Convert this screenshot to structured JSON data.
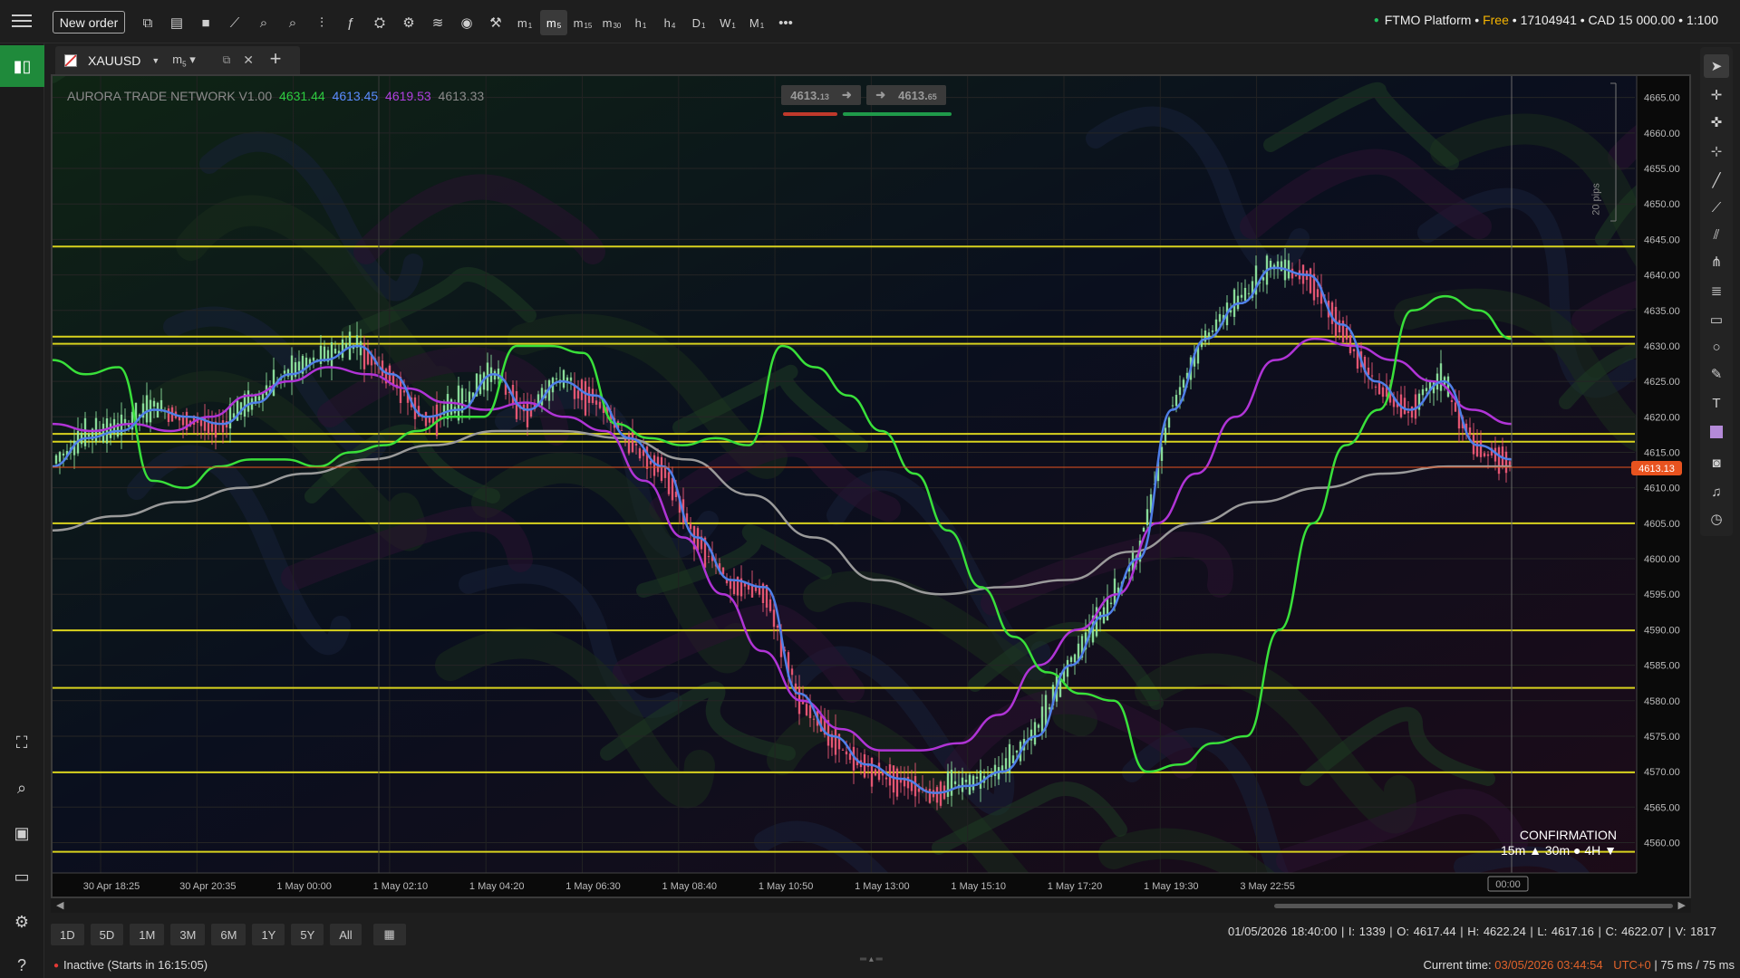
{
  "topbar": {
    "new_order": "New order",
    "timeframes": [
      {
        "base": "m",
        "sub": "1"
      },
      {
        "base": "m",
        "sub": "5"
      },
      {
        "base": "m",
        "sub": "15"
      },
      {
        "base": "m",
        "sub": "30"
      },
      {
        "base": "h",
        "sub": "1"
      },
      {
        "base": "h",
        "sub": "4"
      },
      {
        "base": "D",
        "sub": "1"
      },
      {
        "base": "W",
        "sub": "1"
      },
      {
        "base": "M",
        "sub": "1"
      }
    ],
    "active_timeframe": "m5",
    "more": "•••",
    "account_platform": "FTMO Platform",
    "account_sep": " • ",
    "account_plan": "Free",
    "account_id": "• 17104941 • CAD 15 000.00 • 1:100"
  },
  "tab": {
    "symbol": "XAUUSD",
    "timeframe_base": "m",
    "timeframe_sub": "5"
  },
  "chart": {
    "indicator_name": "AURORA TRADE NETWORK V1.00",
    "indicator_values": [
      "4631.44",
      "4613.45",
      "4619.53",
      "4613.33"
    ],
    "bid": "4613.",
    "bid_small": "13",
    "ask": "4613.",
    "ask_small": "65",
    "current_price_label": "4613.13",
    "pips_label": "20 pips",
    "confirmation_title": "CONFIRMATION",
    "confirmation_line": "15m ▲  30m ●  4H ▼",
    "crosshair_time": "00:00",
    "colors": {
      "green_line": "#39e03a",
      "blue_line": "#4f7fe8",
      "purple_line": "#b034d6",
      "gray_line": "#9a9a9a",
      "levels": "#d8d21e",
      "bull_candle": "#8fe6a0",
      "bear_candle": "#f05a78",
      "price_tag": "#e8531f"
    }
  },
  "chart_data": {
    "type": "line",
    "symbol": "XAUUSD",
    "timeframe": "m5",
    "ylim": [
      4557,
      4667
    ],
    "y_ticks": [
      4665,
      4660,
      4655,
      4650,
      4645,
      4640,
      4635,
      4630,
      4625,
      4620,
      4615,
      4610,
      4605,
      4600,
      4595,
      4590,
      4585,
      4580,
      4575,
      4570,
      4565,
      4560
    ],
    "x_tick_labels": [
      "30 Apr 18:25",
      "30 Apr 20:35",
      "1 May 00:00",
      "1 May 02:10",
      "1 May 04:20",
      "1 May 06:30",
      "1 May 08:40",
      "1 May 10:50",
      "1 May 13:00",
      "1 May 15:10",
      "1 May 17:20",
      "1 May 19:30",
      "3 May 22:55"
    ],
    "horizontal_levels": [
      4644,
      4631.3,
      4630.3,
      4617.6,
      4616.5,
      4605,
      4589.9,
      4581.8,
      4569.9,
      4558.7
    ],
    "current_price": 4613.13,
    "series": [
      {
        "name": "4631.44",
        "color": "#39e03a",
        "values": [
          4628,
          4626,
          4627,
          4611,
          4610,
          4613,
          4614,
          4614,
          4613,
          4615,
          4616,
          4618,
          4620,
          4620,
          4630,
          4630,
          4629,
          4619,
          4617,
          4616,
          4617,
          4616,
          4630,
          4627,
          4623,
          4618,
          4612,
          4604,
          4596,
          4589,
          4584,
          4581,
          4580,
          4570,
          4571,
          4574,
          4575,
          4590,
          4605,
          4616,
          4621,
          4635,
          4637,
          4635,
          4631
        ]
      },
      {
        "name": "4613.45",
        "color": "#4f7fe8",
        "values": [
          4613,
          4617,
          4618,
          4621,
          4620,
          4619,
          4622,
          4626,
          4628,
          4630,
          4626,
          4620,
          4621,
          4626,
          4621,
          4625,
          4623,
          4617,
          4613,
          4603,
          4597,
          4596,
          4581,
          4575,
          4571,
          4569,
          4567,
          4568,
          4570,
          4575,
          4585,
          4592,
          4600,
          4621,
          4631,
          4636,
          4641,
          4640,
          4633,
          4625,
          4621,
          4625,
          4616,
          4614
        ]
      },
      {
        "name": "4619.53",
        "color": "#b034d6",
        "values": [
          4619,
          4618,
          4619,
          4618,
          4620,
          4623,
          4625,
          4627,
          4626,
          4624,
          4622,
          4621,
          4622,
          4620,
          4618,
          4611,
          4603,
          4595,
          4587,
          4580,
          4576,
          4573,
          4573,
          4574,
          4578,
          4585,
          4590,
          4595,
          4605,
          4612,
          4620,
          4628,
          4631,
          4630,
          4628,
          4625,
          4621,
          4619
        ]
      },
      {
        "name": "4613.33",
        "color": "#9a9a9a",
        "values": [
          4604,
          4606,
          4608,
          4610,
          4612,
          4614,
          4616,
          4618,
          4618,
          4617,
          4614,
          4609,
          4603,
          4597,
          4595,
          4596,
          4597,
          4601,
          4605,
          4608,
          4610,
          4612,
          4613,
          4613
        ]
      }
    ],
    "candles_note": "green/red candlesticks clustered around the blue line"
  },
  "ranges": [
    "1D",
    "5D",
    "1M",
    "3M",
    "6M",
    "1Y",
    "5Y",
    "All"
  ],
  "ohlc": "01/05/2026 18:40:00  |  I: 1339  |  O: 4617.44  |  H: 4622.24  |  L: 4617.16  |  C: 4622.07  |  V: 1817",
  "status": {
    "inactive": "Inactive (Starts in 16:15:05)",
    "current_time_label": "Current time:",
    "current_time_value": "03/05/2026 03:44:54",
    "utc": "UTC+0",
    "latency": "| 75 ms / 75 ms"
  }
}
